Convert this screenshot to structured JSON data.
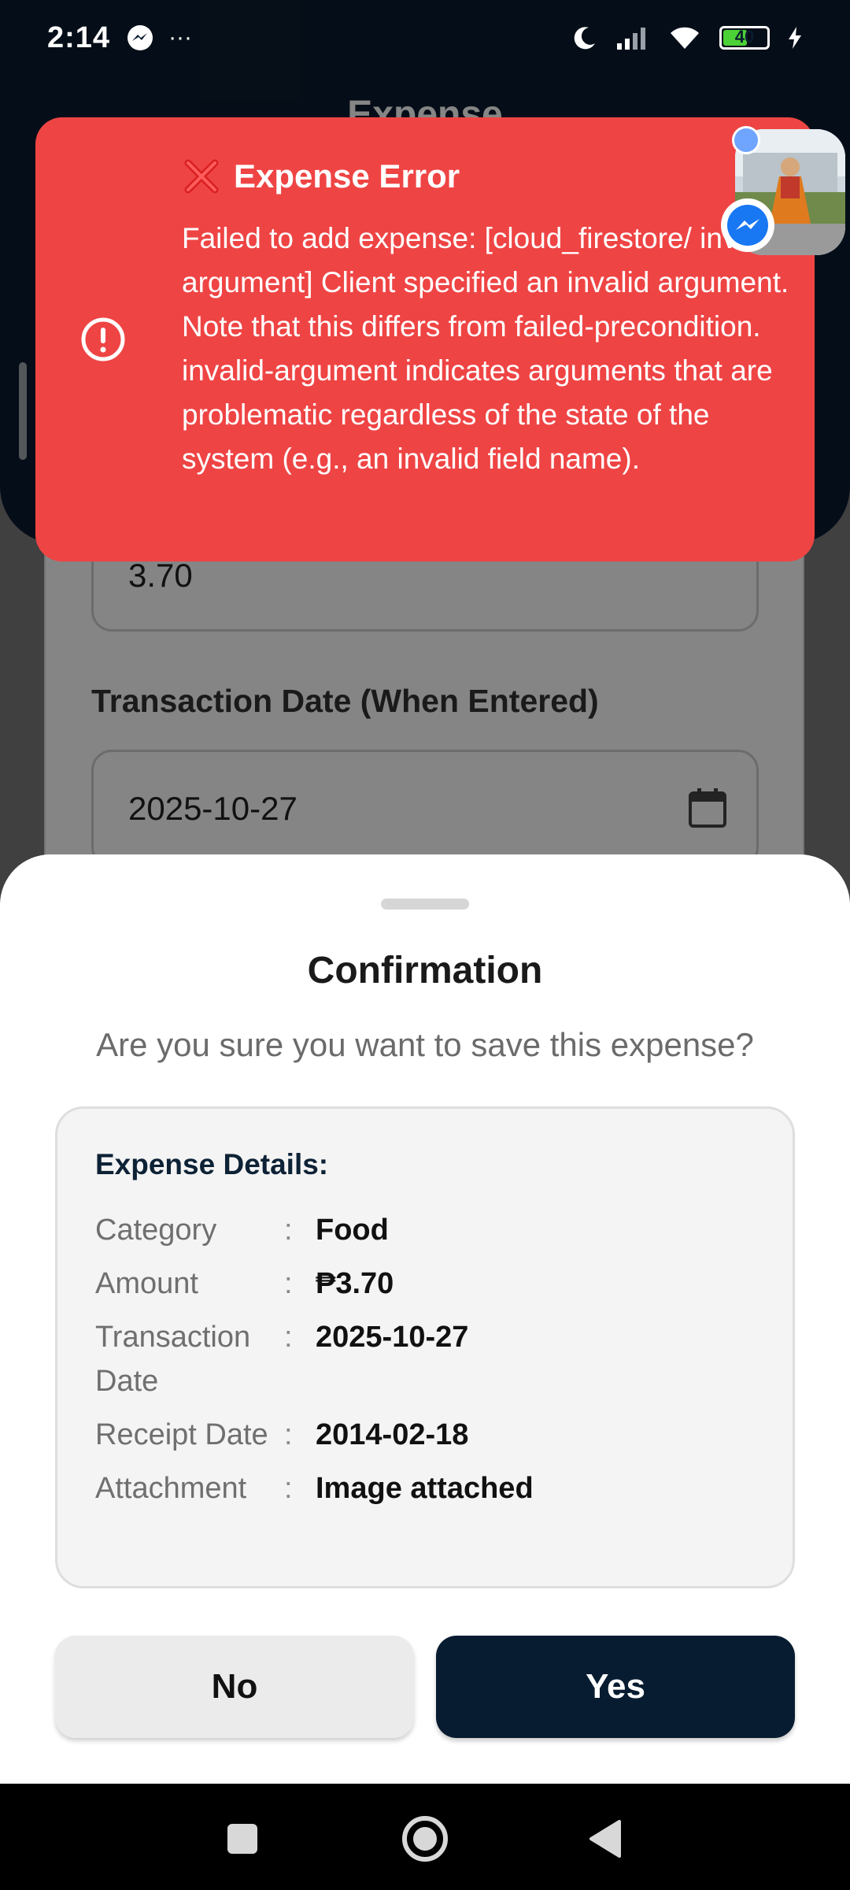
{
  "status_bar": {
    "time": "2:14",
    "battery_level": "40",
    "more_indicator": "···"
  },
  "header": {
    "title": "Expense"
  },
  "form": {
    "amount_value": "3.70",
    "transaction_date_label": "Transaction Date (When Entered)",
    "transaction_date_value": "2025-10-27"
  },
  "toast": {
    "title": "Expense Error",
    "message": "Failed to add expense: [cloud_firestore/ invalid-argument] Client specified an invalid argument. Note that this differs from failed-precondition. invalid-argument indicates arguments that are problematic regardless of the state of the system (e.g., an invalid field name).",
    "color": "#ef4444"
  },
  "confirmation": {
    "title": "Confirmation",
    "question": "Are you sure you want to save this expense?",
    "details_heading": "Expense Details:",
    "separator": ":",
    "rows": [
      {
        "label": "Category",
        "value": "Food"
      },
      {
        "label": "Amount",
        "value": "₱3.70"
      },
      {
        "label": "Transaction Date",
        "value": "2025-10-27"
      },
      {
        "label": "Receipt Date",
        "value": "2014-02-18"
      },
      {
        "label": "Attachment",
        "value": "Image attached"
      }
    ],
    "no_label": "No",
    "yes_label": "Yes",
    "accent": "#081c31"
  },
  "icons": {
    "toast_alert": "exclamation-circle-icon",
    "toast_title": "cross-mark-icon",
    "calendar": "calendar-icon",
    "chat_badge": "messenger-icon",
    "nav": [
      "square-recents-icon",
      "circle-home-icon",
      "triangle-back-icon"
    ]
  }
}
